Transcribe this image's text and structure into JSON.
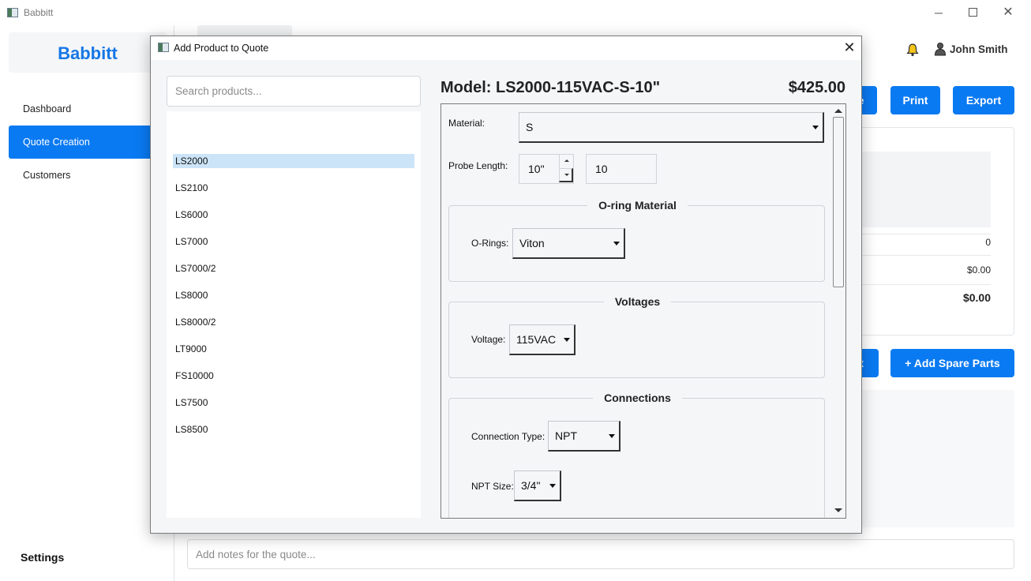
{
  "window": {
    "title": "Babbitt"
  },
  "sidebar": {
    "brand": "Babbitt",
    "items": [
      {
        "label": "Dashboard"
      },
      {
        "label": "Quote Creation"
      },
      {
        "label": "Customers"
      }
    ],
    "settings": "Settings"
  },
  "header": {
    "user_name": "John Smith"
  },
  "toolbar": {
    "save_label": "e",
    "print_label": "Print",
    "export_label": "Export",
    "add_product_label": "t",
    "add_spare_parts_label": "+ Add Spare Parts"
  },
  "summary": {
    "items_count": "0",
    "subtotal": "$0.00",
    "total": "$0.00"
  },
  "notes": {
    "placeholder": "Add notes for the quote..."
  },
  "dialog": {
    "title": "Add Product to Quote",
    "search_placeholder": "Search products...",
    "products": [
      "LS2000",
      "LS2100",
      "LS6000",
      "LS7000",
      "LS7000/2",
      "LS8000",
      "LS8000/2",
      "LT9000",
      "FS10000",
      "LS7500",
      "LS8500"
    ],
    "selected_product": "LS2000",
    "model_title": "Model: LS2000-115VAC-S-10\"",
    "price": "$425.00",
    "config": {
      "material_label": "Material:",
      "material_value": "S",
      "probe_length_label": "Probe Length:",
      "probe_length_value": "10\"",
      "probe_length_custom": "10",
      "oring_group_title": "O-ring Material",
      "orings_label": "O-Rings:",
      "orings_value": "Viton",
      "voltages_group_title": "Voltages",
      "voltage_label": "Voltage:",
      "voltage_value": "115VAC",
      "connections_group_title": "Connections",
      "connection_type_label": "Connection Type:",
      "connection_type_value": "NPT",
      "npt_size_label": "NPT Size:",
      "npt_size_value": "3/4\""
    }
  },
  "colors": {
    "accent": "#0a7af2",
    "brand": "#1677e6",
    "selection": "#cce4f7"
  },
  "icons": {
    "bell": "bell-icon",
    "user": "user-icon"
  }
}
